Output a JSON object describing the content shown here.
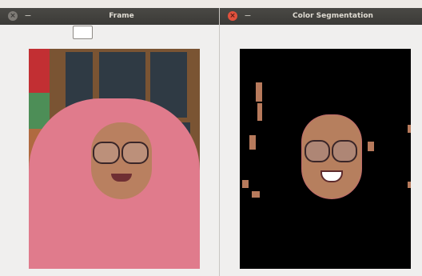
{
  "windows": [
    {
      "title": "Frame",
      "toolbar_box": "",
      "image_alt": "camera frame"
    },
    {
      "title": "Color Segmentation",
      "image_alt": "segmented skin region"
    }
  ],
  "icons": {
    "close": "close-icon",
    "minimize": "minimize-icon"
  },
  "colors": {
    "titlebar": "#3b3a37",
    "close_active": "#e2513d",
    "window_bg": "#f0efee"
  }
}
